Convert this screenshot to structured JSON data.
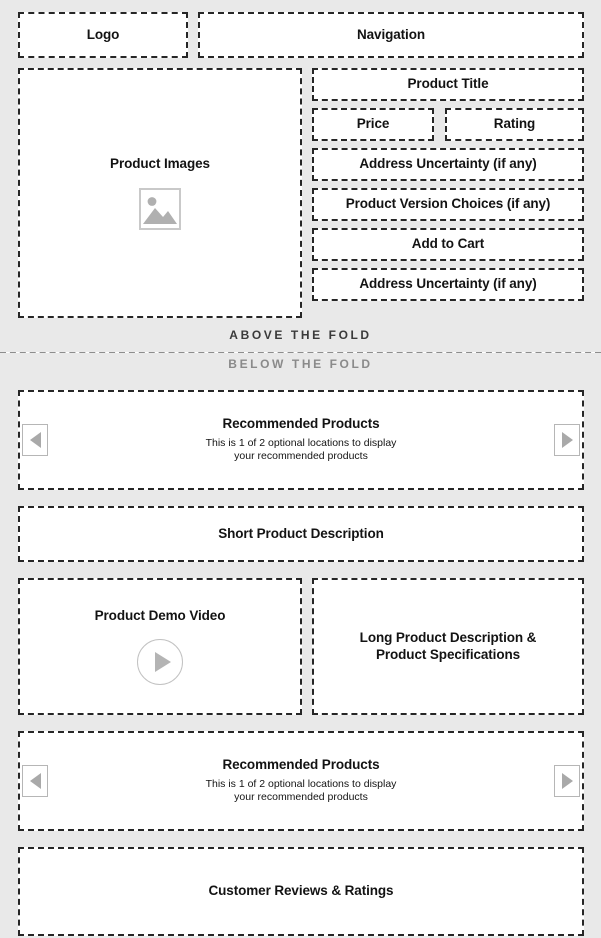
{
  "above_fold": {
    "header": {
      "logo_label": "Logo",
      "navigation_label": "Navigation"
    },
    "hero": {
      "product_images_label": "Product Images",
      "product_images_icon": "image-placeholder-icon",
      "product_title_label": "Product Title",
      "price_label": "Price",
      "rating_label": "Rating",
      "address_uncertainty_top_label": "Address Uncertainty (if any)",
      "product_version_choices_label": "Product Version Choices (if any)",
      "add_to_cart_label": "Add to Cart",
      "address_uncertainty_bottom_label": "Address Uncertainty (if any)"
    },
    "band_label": "ABOVE THE FOLD"
  },
  "below_fold": {
    "band_label": "BELOW THE FOLD",
    "recommended_top": {
      "title": "Recommended Products",
      "subtitle_line1": "This is 1 of 2 optional locations to display",
      "subtitle_line2": "your recommended products",
      "prev_icon": "chevron-left-icon",
      "next_icon": "chevron-right-icon"
    },
    "short_description_label": "Short Product Description",
    "video": {
      "label": "Product Demo Video",
      "play_icon": "play-icon"
    },
    "long_description": {
      "line1": "Long Product Description &",
      "line2": "Product Specifications"
    },
    "recommended_bottom": {
      "title": "Recommended Products",
      "subtitle_line1": "This is 1 of 2 optional locations to display",
      "subtitle_line2": "your recommended products",
      "prev_icon": "chevron-left-icon",
      "next_icon": "chevron-right-icon"
    },
    "reviews_label": "Customer Reviews & Ratings"
  },
  "colors": {
    "band_background": "#e9e9e9",
    "box_border": "#262626",
    "box_fill": "#ffffff",
    "fold_line": "#8d8d8d",
    "icon_gray": "#a9a9a9",
    "above_fold_text": "#3a3a3a",
    "below_fold_text": "#8a8a8a"
  }
}
